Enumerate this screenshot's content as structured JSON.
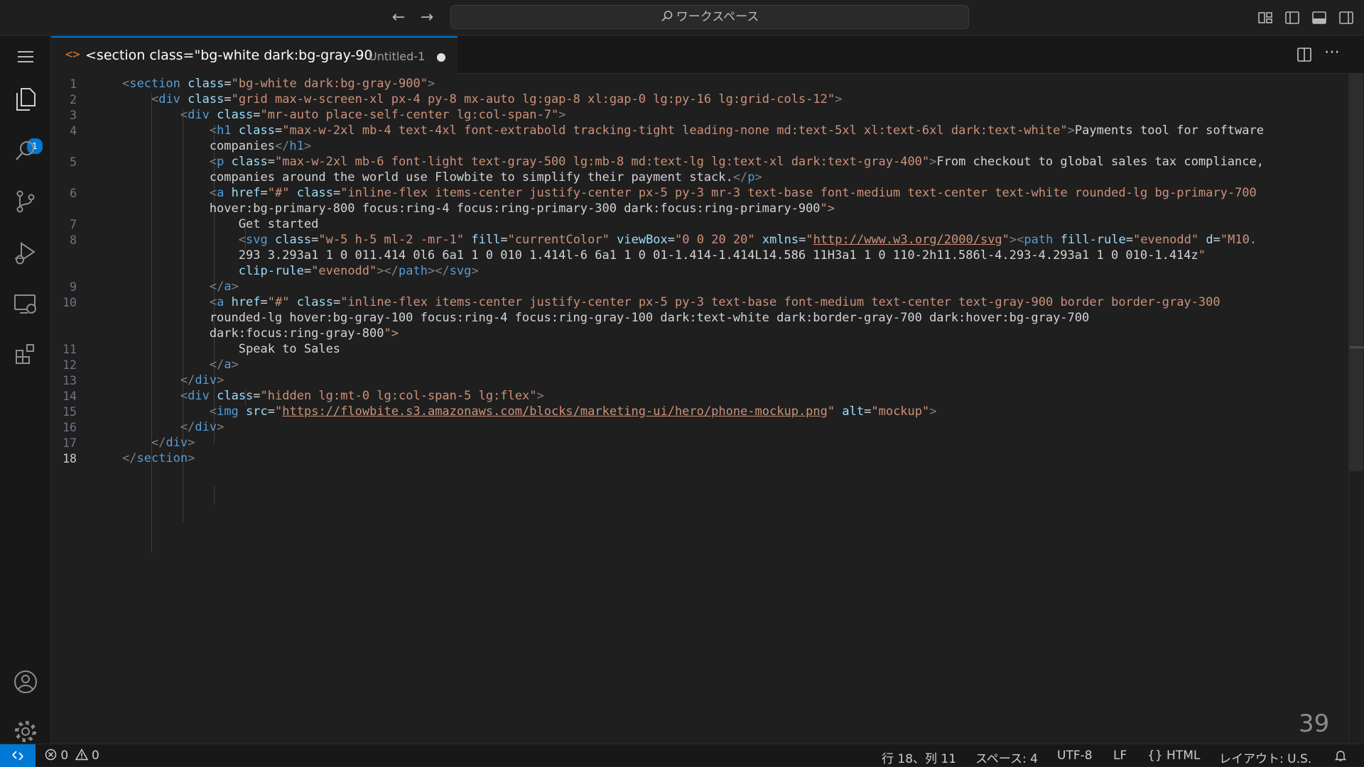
{
  "titlebar": {
    "search_label": "ワークスペース",
    "back_icon": "arrow-left-icon",
    "forward_icon": "arrow-right-icon"
  },
  "activity": {
    "explorer_badge": "1"
  },
  "tab": {
    "title": "<section class=\"bg-white dark:bg-gray-90",
    "description": "Untitled-1",
    "dirty": true
  },
  "editor": {
    "active_line": 18,
    "line_numbers": [
      "1",
      "2",
      "3",
      "4",
      "5",
      "6",
      "7",
      "8",
      "9",
      "10",
      "11",
      "12",
      "13",
      "14",
      "15",
      "16",
      "17",
      "18"
    ],
    "lines": [
      "<section class=\"bg-white dark:bg-gray-900\">",
      "    <div class=\"grid max-w-screen-xl px-4 py-8 mx-auto lg:gap-8 xl:gap-0 lg:py-16 lg:grid-cols-12\">",
      "        <div class=\"mr-auto place-self-center lg:col-span-7\">",
      "            <h1 class=\"max-w-2xl mb-4 text-4xl font-extrabold tracking-tight leading-none md:text-5xl xl:text-6xl dark:text-white\">Payments tool for software",
      "            companies</h1>",
      "            <p class=\"max-w-2xl mb-6 font-light text-gray-500 lg:mb-8 md:text-lg lg:text-xl dark:text-gray-400\">From checkout to global sales tax compliance,",
      "            companies around the world use Flowbite to simplify their payment stack.</p>",
      "            <a href=\"#\" class=\"inline-flex items-center justify-center px-5 py-3 mr-3 text-base font-medium text-center text-white rounded-lg bg-primary-700",
      "            hover:bg-primary-800 focus:ring-4 focus:ring-primary-300 dark:focus:ring-primary-900\">",
      "                Get started",
      "                <svg class=\"w-5 h-5 ml-2 -mr-1\" fill=\"currentColor\" viewBox=\"0 0 20 20\" xmlns=\"http://www.w3.org/2000/svg\"><path fill-rule=\"evenodd\" d=\"M10.",
      "                293 3.293a1 1 0 011.414 0l6 6a1 1 0 010 1.414l-6 6a1 1 0 01-1.414-1.414L14.586 11H3a1 1 0 110-2h11.586l-4.293-4.293a1 1 0 010-1.414z\"",
      "                clip-rule=\"evenodd\"></path></svg>",
      "            </a>",
      "            <a href=\"#\" class=\"inline-flex items-center justify-center px-5 py-3 text-base font-medium text-center text-gray-900 border border-gray-300",
      "            rounded-lg hover:bg-gray-100 focus:ring-4 focus:ring-gray-100 dark:text-white dark:border-gray-700 dark:hover:bg-gray-700",
      "            dark:focus:ring-gray-800\">",
      "                Speak to Sales",
      "            </a>",
      "        </div>",
      "        <div class=\"hidden lg:mt-0 lg:col-span-5 lg:flex\">",
      "            <img src=\"https://flowbite.s3.amazonaws.com/blocks/marketing-ui/hero/phone-mockup.png\" alt=\"mockup\">",
      "        </div>",
      "    </div>",
      "</section>"
    ]
  },
  "watermark": "39",
  "statusbar": {
    "errors": "0",
    "warnings": "0",
    "position": "行 18、列 11",
    "indent": "スペース: 4",
    "encoding": "UTF-8",
    "eol": "LF",
    "language": "HTML",
    "layout": "レイアウト: U.S."
  },
  "colors": {
    "accent": "#0078d4",
    "tag": "#569cd6",
    "attr": "#9cdcfe",
    "string": "#ce9178"
  }
}
